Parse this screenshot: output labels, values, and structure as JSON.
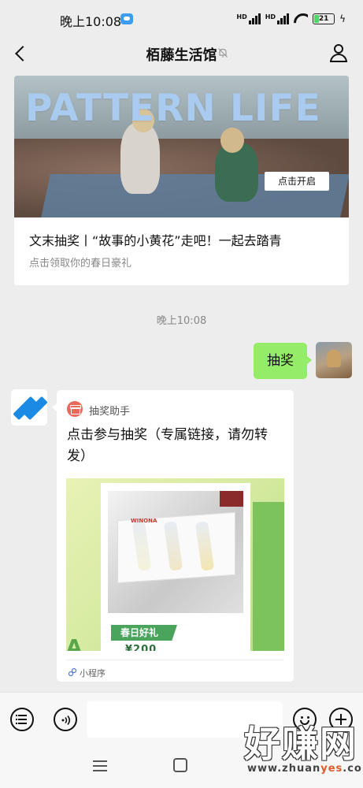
{
  "status_bar": {
    "time": "晚上10:08",
    "hd1": "HD",
    "hd2": "HD",
    "battery": "21"
  },
  "header": {
    "title": "栢藤生活馆"
  },
  "article": {
    "cover_text": "PATTERN LIFE",
    "cover_button": "点击开启",
    "title": "文末抽奖丨“故事的小黄花”走吧！一起去踏青",
    "subtitle": "点击领取你的春日豪礼"
  },
  "timestamp": "晚上10:08",
  "my_message": {
    "text": "抽奖"
  },
  "mini_program": {
    "app_name": "抽奖助手",
    "title": "点击参与抽奖（专属链接，请勿转发）",
    "image_tag": "春日好礼",
    "image_price": "¥200",
    "image_brand": "WINONA",
    "footer": "小程序"
  },
  "input_bar": {
    "placeholder": ""
  },
  "watermark": {
    "main": "好赚网",
    "url_prefix": "www.zhuan",
    "url_highlight": "yes",
    "url_suffix": ".com"
  },
  "colors": {
    "chat_background": "#ededed",
    "my_bubble": "#95ec69",
    "mini_program_icon": "#e96a5a",
    "bot_avatar_accent": "#1a8ae5"
  }
}
